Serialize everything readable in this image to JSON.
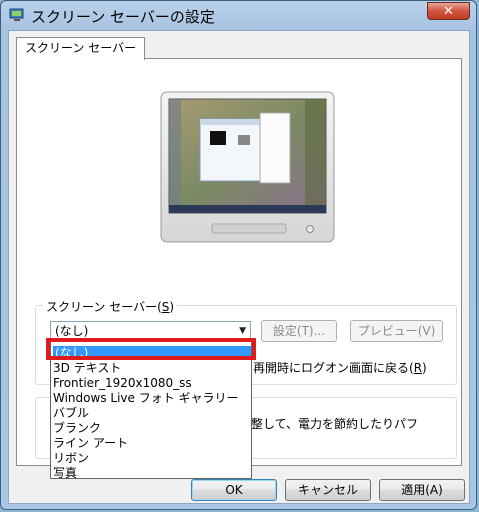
{
  "window": {
    "title": "スクリーン セーバーの設定",
    "close_glyph": "✕"
  },
  "tab": {
    "label": "スクリーン セーバー"
  },
  "screensaver_group": {
    "legend": "スクリーン セーバー(",
    "legend_key": "S",
    "legend_end": ")",
    "combo_value": "(なし)",
    "settings_button": "設定(T)...",
    "preview_button": "プレビュー(V)",
    "logon_text_fragment": "再開時にログオン画面に戻る(",
    "logon_key": "R",
    "logon_end": ")"
  },
  "dropdown": {
    "items": [
      "(なし)",
      "3D テキスト",
      "Frontier_1920x1080_ss",
      "Windows Live フォト ギャラリー",
      "バブル",
      "ブランク",
      "ライン アート",
      "リボン",
      "写真"
    ],
    "selected_index": 0
  },
  "power_group": {
    "text_fragment": "整して、電力を節約したりパフ"
  },
  "footer": {
    "ok": "OK",
    "cancel": "キャンセル",
    "apply": "適用(A)"
  },
  "icons": {
    "window_icon": "monitor-gear-icon",
    "close": "close-icon",
    "dropdown_arrow": "chevron-down-icon"
  },
  "colors": {
    "selection": "#3399ff",
    "annotation_box": "#e01b1b"
  }
}
